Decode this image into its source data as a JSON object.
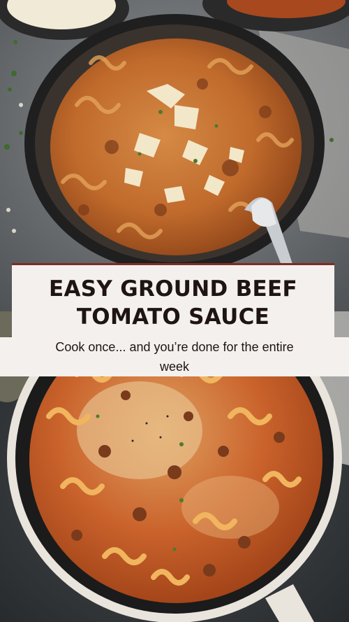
{
  "title": {
    "line1": "EASY GROUND BEEF",
    "line2": "TOMATO SAUCE"
  },
  "subtitle": {
    "line1": "Cook once... and you’re done for the entire",
    "line2": "week"
  },
  "colors": {
    "panel_bg": "#f4f0ee",
    "accent_bar": "#7c2d25",
    "title_text": "#1e1412"
  }
}
